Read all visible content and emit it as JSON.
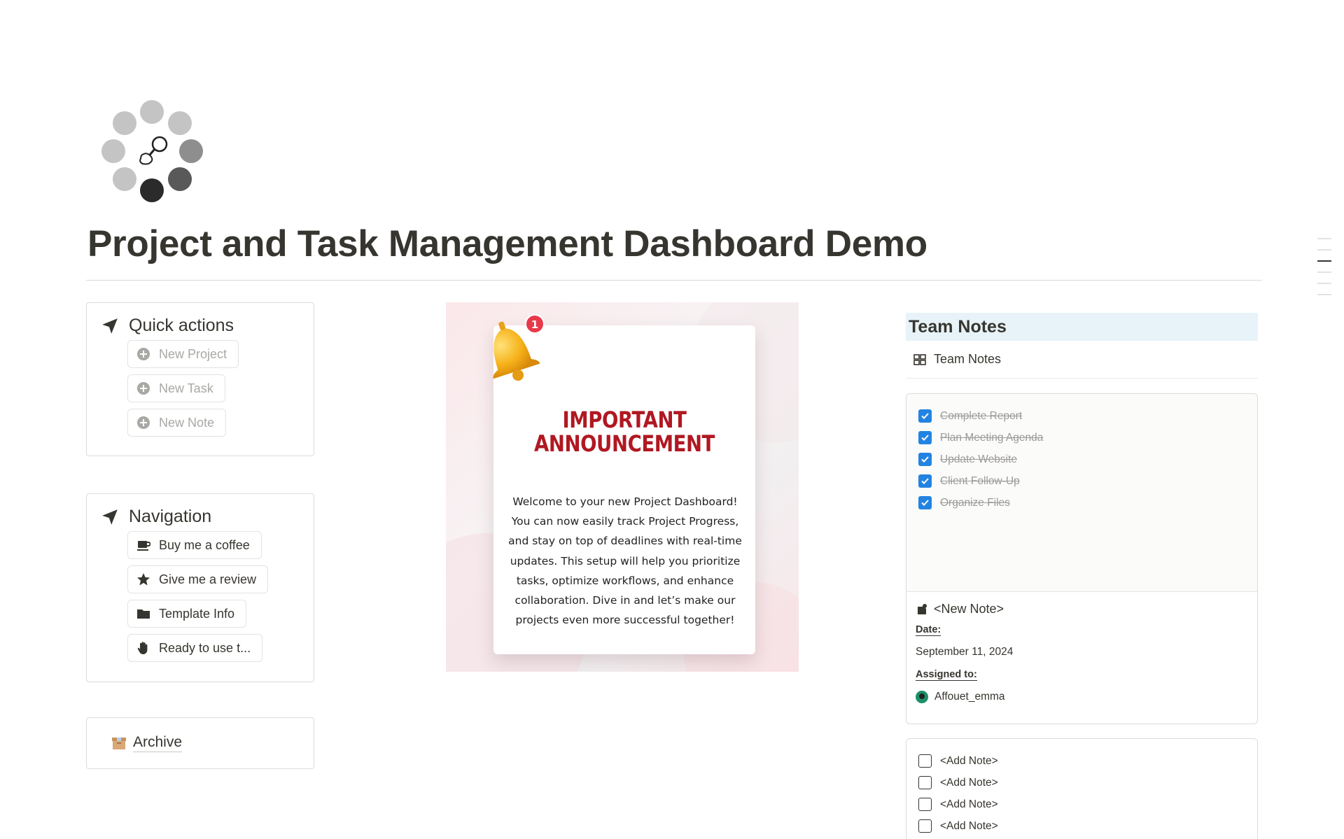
{
  "page": {
    "title": "Project and Task Management Dashboard Demo",
    "icon": "people-circle-search-icon"
  },
  "quick_actions": {
    "heading": "Quick actions",
    "icon": "navigation-arrow-icon",
    "buttons": [
      {
        "label": "New Project",
        "icon": "plus-circle-icon"
      },
      {
        "label": "New Task",
        "icon": "plus-circle-icon"
      },
      {
        "label": "New Note",
        "icon": "plus-circle-icon"
      }
    ]
  },
  "navigation": {
    "heading": "Navigation",
    "icon": "navigation-arrow-icon",
    "buttons": [
      {
        "label": "Buy me a coffee",
        "icon": "coffee-icon"
      },
      {
        "label": "Give me a review",
        "icon": "star-icon"
      },
      {
        "label": "Template Info",
        "icon": "folder-icon"
      },
      {
        "label": "Ready to use t...",
        "icon": "hand-icon"
      }
    ]
  },
  "archive": {
    "label": "Archive",
    "icon": "archive-box-icon"
  },
  "announcement": {
    "heading_line1": "IMPORTANT",
    "heading_line2": "ANNOUNCEMENT",
    "badge": "1",
    "body": "Welcome to your new Project Dashboard! You can now easily track Project Progress, and stay on top of deadlines with real-time updates. This setup will help you prioritize tasks, optimize workflows, and enhance collaboration. Dive in and let’s make our projects even more successful together!"
  },
  "team_notes": {
    "heading": "Team Notes",
    "view_label": "Team Notes",
    "view_icon": "gallery-grid-icon",
    "card1": {
      "todos": [
        {
          "text": "Complete Report",
          "checked": true
        },
        {
          "text": "Plan Meeting Agenda",
          "checked": true
        },
        {
          "text": "Update Website",
          "checked": true
        },
        {
          "text": "Client Follow-Up",
          "checked": true
        },
        {
          "text": "Organize Files",
          "checked": true
        }
      ],
      "title": "<New Note>",
      "title_icon": "note-icon",
      "date_label": "Date:",
      "date_value": "September 11, 2024",
      "assigned_label": "Assigned to:",
      "assigned_value": "Affouet_emma"
    },
    "card2": {
      "todos": [
        {
          "text": "<Add Note>",
          "checked": false
        },
        {
          "text": "<Add Note>",
          "checked": false
        },
        {
          "text": "<Add Note>",
          "checked": false
        },
        {
          "text": "<Add Note>",
          "checked": false
        }
      ]
    }
  },
  "colors": {
    "accent_blue": "#2383e2",
    "announcement_red": "#b01822",
    "team_notes_header_bg": "#e7f3f8"
  }
}
